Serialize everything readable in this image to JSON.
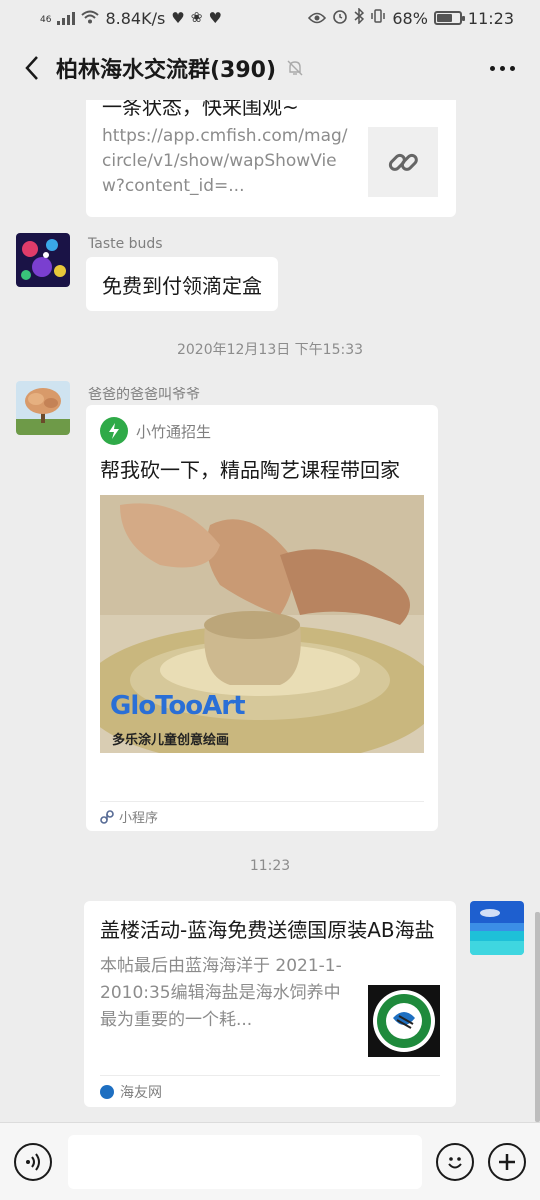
{
  "status_bar": {
    "network": "46",
    "speed": "8.84K/s",
    "battery": "68%",
    "battery_level": 0.68,
    "time": "11:23"
  },
  "header": {
    "title": "柏林海水交流群(390)"
  },
  "messages": {
    "link_card_1": {
      "title": "一条状态，快来围观~",
      "url": "https://app.cmfish.com/mag/circle/v1/show/wapShowView?content_id=..."
    },
    "taste_buds": {
      "sender": "Taste buds",
      "text": "免费到付领滴定盒"
    },
    "timestamp_1": "2020年12月13日 下午15:33",
    "mini_program": {
      "sender": "爸爸的爸爸叫爷爷",
      "source": "小竹通招生",
      "title": "帮我砍一下，精品陶艺课程带回家",
      "image_brand": "GloTooArt",
      "image_tagline": "多乐涂儿童创意绘画",
      "footer": "小程序"
    },
    "timestamp_2": "11:23",
    "link_card_2": {
      "title": "盖楼活动-蓝海免费送德国原装AB海盐",
      "desc": "本帖最后由蓝海海洋于 2021-1-2010:35编辑海盐是海水饲养中最为重要的一个耗...",
      "source": "海友网"
    }
  },
  "colors": {
    "background": "#ededed",
    "bubble": "#ffffff",
    "mini_program_logo": "#2faa48",
    "secondary_text": "#8c8c8c"
  },
  "icons": [
    "back-arrow-icon",
    "mute-bell-icon",
    "more-icon",
    "link-icon",
    "voice-icon",
    "emoji-icon",
    "add-icon",
    "mini-program-icon"
  ]
}
